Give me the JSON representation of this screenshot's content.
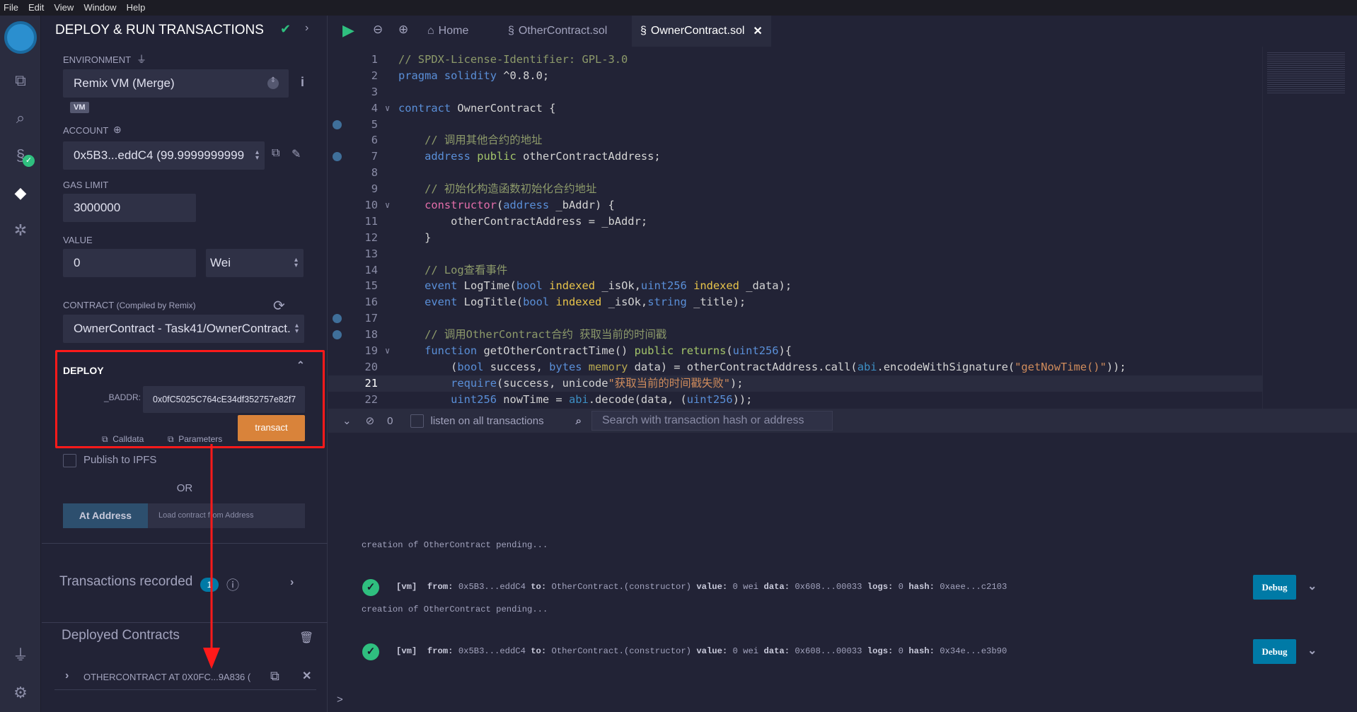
{
  "menu": [
    "File",
    "Edit",
    "View",
    "Window",
    "Help"
  ],
  "sidebar": {
    "title": "DEPLOY & RUN TRANSACTIONS",
    "environment_label": "ENVIRONMENT",
    "environment": "Remix VM (Merge)",
    "vm_badge": "VM",
    "account_label": "ACCOUNT",
    "account": "0x5B3...eddC4 (99.9999999999",
    "gas_limit_label": "GAS LIMIT",
    "gas_limit": "3000000",
    "value_label": "VALUE",
    "value": "0",
    "unit": "Wei",
    "contract_label": "CONTRACT",
    "contract_note": "(Compiled by Remix)",
    "contract": "OwnerContract - Task41/OwnerContract.",
    "deploy": {
      "label": "DEPLOY",
      "param_label": "_BADDR:",
      "param_value": "0x0fC5025C764cE34df352757e82f7",
      "calldata": "Calldata",
      "parameters": "Parameters",
      "transact": "transact"
    },
    "publish_ipfs": "Publish to IPFS",
    "or": "OR",
    "at_address": "At Address",
    "load_placeholder": "Load contract from Address",
    "tx_recorded": "Transactions recorded",
    "tx_count": "1",
    "deployed_contracts": "Deployed Contracts",
    "deployed_item": "OTHERCONTRACT AT 0X0FC...9A836 ("
  },
  "tabs": [
    {
      "label": "Home"
    },
    {
      "label": "OtherContract.sol"
    },
    {
      "label": "OwnerContract.sol",
      "active": true
    }
  ],
  "code": [
    [
      [
        "// SPDX-License-Identifier: GPL-3.0",
        "c-com"
      ]
    ],
    [
      [
        "pragma solidity",
        "c-kw"
      ],
      [
        " ^0.8.0;",
        ""
      ]
    ],
    [],
    [
      [
        "contract",
        "c-kw"
      ],
      [
        " OwnerContract {",
        ""
      ]
    ],
    [],
    [
      [
        "    // 调用其他合约的地址",
        "c-com"
      ]
    ],
    [
      [
        "    address",
        "c-kw"
      ],
      [
        " "
      ],
      [
        "public",
        "c-grn"
      ],
      [
        " otherContractAddress;",
        ""
      ]
    ],
    [],
    [
      [
        "    // 初始化构造函数初始化合约地址",
        "c-com"
      ]
    ],
    [
      [
        "    constructor",
        "c-pink"
      ],
      [
        "(",
        ""
      ],
      [
        "address",
        "c-kw"
      ],
      [
        " _bAddr) {",
        ""
      ]
    ],
    [
      [
        "        otherContractAddress = _bAddr;",
        ""
      ]
    ],
    [
      [
        "    }",
        ""
      ]
    ],
    [],
    [
      [
        "    // Log查看事件",
        "c-com"
      ]
    ],
    [
      [
        "    event",
        "c-kw"
      ],
      [
        " LogTime(",
        ""
      ],
      [
        "bool",
        "c-kw"
      ],
      [
        " ",
        ""
      ],
      [
        "indexed",
        "c-yel"
      ],
      [
        " _isOk,",
        ""
      ],
      [
        "uint256",
        "c-kw"
      ],
      [
        " ",
        ""
      ],
      [
        "indexed",
        "c-yel"
      ],
      [
        " _data);",
        ""
      ]
    ],
    [
      [
        "    event",
        "c-kw"
      ],
      [
        " LogTitle(",
        ""
      ],
      [
        "bool",
        "c-kw"
      ],
      [
        " ",
        ""
      ],
      [
        "indexed",
        "c-yel"
      ],
      [
        " _isOk,",
        ""
      ],
      [
        "string",
        "c-kw"
      ],
      [
        " _title);",
        ""
      ]
    ],
    [],
    [
      [
        "    // 调用OtherContract合约 获取当前的时间戳",
        "c-com"
      ]
    ],
    [
      [
        "    function",
        "c-kw"
      ],
      [
        " getOtherContractTime() ",
        ""
      ],
      [
        "public",
        "c-grn"
      ],
      [
        " ",
        ""
      ],
      [
        "returns",
        "c-grn"
      ],
      [
        "(",
        ""
      ],
      [
        "uint256",
        "c-kw"
      ],
      [
        "){",
        ""
      ]
    ],
    [
      [
        "        (",
        ""
      ],
      [
        "bool",
        "c-kw"
      ],
      [
        " success, ",
        ""
      ],
      [
        "bytes",
        "c-kw"
      ],
      [
        " ",
        ""
      ],
      [
        "memory",
        "c-mem"
      ],
      [
        " data) = otherContractAddress.call(",
        ""
      ],
      [
        "abi",
        "c-abi"
      ],
      [
        ".encodeWithSignature(",
        ""
      ],
      [
        "\"getNowTime()\"",
        "c-str"
      ],
      [
        "));",
        ""
      ]
    ],
    [
      [
        "        require",
        "c-kw"
      ],
      [
        "(success, unicode",
        ""
      ],
      [
        "\"获取当前的时间戳失败\"",
        "c-str"
      ],
      [
        ");",
        ""
      ]
    ],
    [
      [
        "        uint256",
        "c-kw"
      ],
      [
        " nowTime = ",
        ""
      ],
      [
        "abi",
        "c-abi"
      ],
      [
        ".decode(data, (",
        ""
      ],
      [
        "uint256",
        "c-kw"
      ],
      [
        "));",
        ""
      ]
    ]
  ],
  "breakpoints": [
    5,
    7,
    17,
    18
  ],
  "folds": [
    4,
    10,
    19
  ],
  "current_line": 21,
  "terminal": {
    "count": "0",
    "listen": "listen on all transactions",
    "search_placeholder": "Search with transaction hash or address",
    "logs": [
      {
        "type": "text",
        "text": "creation of OtherContract pending..."
      },
      {
        "type": "tx",
        "vm": "[vm]",
        "from": "0x5B3...eddC4",
        "to": "OtherContract.(constructor)",
        "value": "0 wei",
        "data": "0x608...00033",
        "logs": "0",
        "hash": "0xaee...c2103",
        "debug": "Debug"
      },
      {
        "type": "text",
        "text": "creation of OtherContract pending..."
      },
      {
        "type": "tx",
        "vm": "[vm]",
        "from": "0x5B3...eddC4",
        "to": "OtherContract.(constructor)",
        "value": "0 wei",
        "data": "0x608...00033",
        "logs": "0",
        "hash": "0x34e...e3b90",
        "debug": "Debug"
      }
    ],
    "prompt": ">"
  },
  "colors": {
    "accent": "#007aa6",
    "transact": "#d9833a",
    "annotation": "#ff1a1a",
    "success": "#2fbf7f"
  }
}
